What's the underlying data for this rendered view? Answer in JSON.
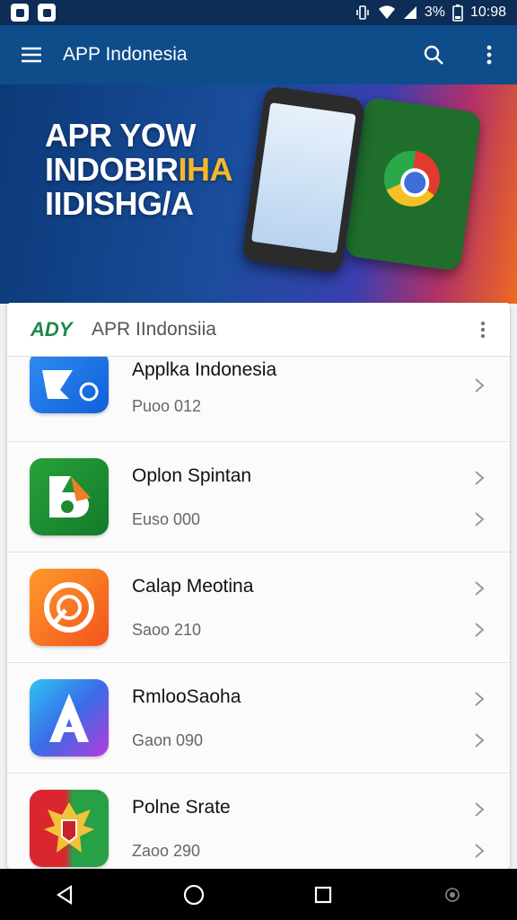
{
  "status_bar": {
    "battery": "3%",
    "time": "10:98"
  },
  "app_bar": {
    "title": "APP Indonesia"
  },
  "banner": {
    "line1": "APR YOW",
    "line2a": "INDOBIR",
    "line2b": "IHA",
    "line3": "IIDISHG/A"
  },
  "card": {
    "logo": "ADY",
    "title": "APR IIndonsiia"
  },
  "apps": [
    {
      "name": "Applka Indonesia",
      "sub": "Puoo 012",
      "icon": "app-icon-blue-arrow"
    },
    {
      "name": "Oplon Spintan",
      "sub": "Euso 000",
      "icon": "app-icon-green-b"
    },
    {
      "name": "Calap Meotina",
      "sub": "Saoo 210",
      "icon": "app-icon-orange-circle"
    },
    {
      "name": "RmlooSaoha",
      "sub": "Gaon 090",
      "icon": "app-icon-gradient-a"
    },
    {
      "name": "Polne Srate",
      "sub": "Zaoo 290",
      "icon": "app-icon-garuda"
    }
  ],
  "colors": {
    "appbar": "#0f4c8a",
    "statusbar": "#0d2d57"
  }
}
